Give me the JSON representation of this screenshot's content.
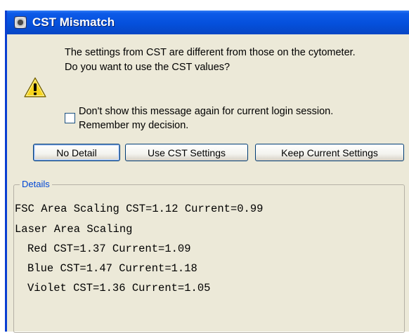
{
  "window": {
    "title": "CST Mismatch"
  },
  "message": {
    "line1": "The settings from CST are different from those on the cytometer.",
    "line2": "Do you want to use the CST values?"
  },
  "checkbox": {
    "checked": false,
    "line1": "Don't show this message again for current login session.",
    "line2": "Remember my decision."
  },
  "buttons": {
    "no_detail": "No Detail",
    "use_cst": "Use CST Settings",
    "keep_current": "Keep Current Settings"
  },
  "details": {
    "legend": "Details",
    "lines": [
      "FSC Area Scaling CST=1.12 Current=0.99",
      "Laser Area Scaling",
      "Red CST=1.37 Current=1.09",
      "Blue CST=1.47 Current=1.18",
      "Violet CST=1.36 Current=1.05"
    ]
  }
}
